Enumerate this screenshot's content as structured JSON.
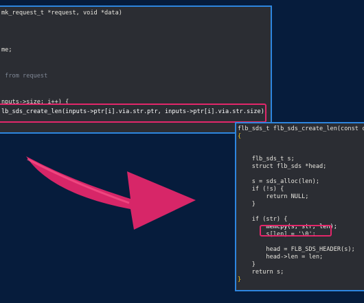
{
  "top_panel": {
    "lines": [
      "mk_request_t *request, void *data)",
      "",
      "",
      "",
      "me;",
      "",
      "",
      "",
      " from request",
      "",
      "",
      "",
      "nputs->size; i++) {",
      "lb_sds_create_len(inputs->ptr[i].via.str.ptr, inputs->ptr[i].via.str.size);"
    ]
  },
  "bottom_panel": {
    "lines": [
      "flb_sds_t flb_sds_create_len(const char",
      "{",
      "",
      "",
      "    flb_sds_t s;",
      "    struct flb_sds *head;",
      "",
      "    s = sds_alloc(len);",
      "    if (!s) {",
      "        return NULL;",
      "    }",
      "",
      "    if (str) {",
      "        memcpy(s, str, len);",
      "        s[len] = '\\0';",
      "",
      "        head = FLB_SDS_HEADER(s);",
      "        head->len = len;",
      "    }",
      "    return s;",
      "}"
    ]
  },
  "colors": {
    "background": "#061c3c",
    "panel": "#2b2d33",
    "panel_border": "#2d86e0",
    "highlight": "#e3276a",
    "keyword": "#f5c518",
    "comment": "#7f8795"
  }
}
